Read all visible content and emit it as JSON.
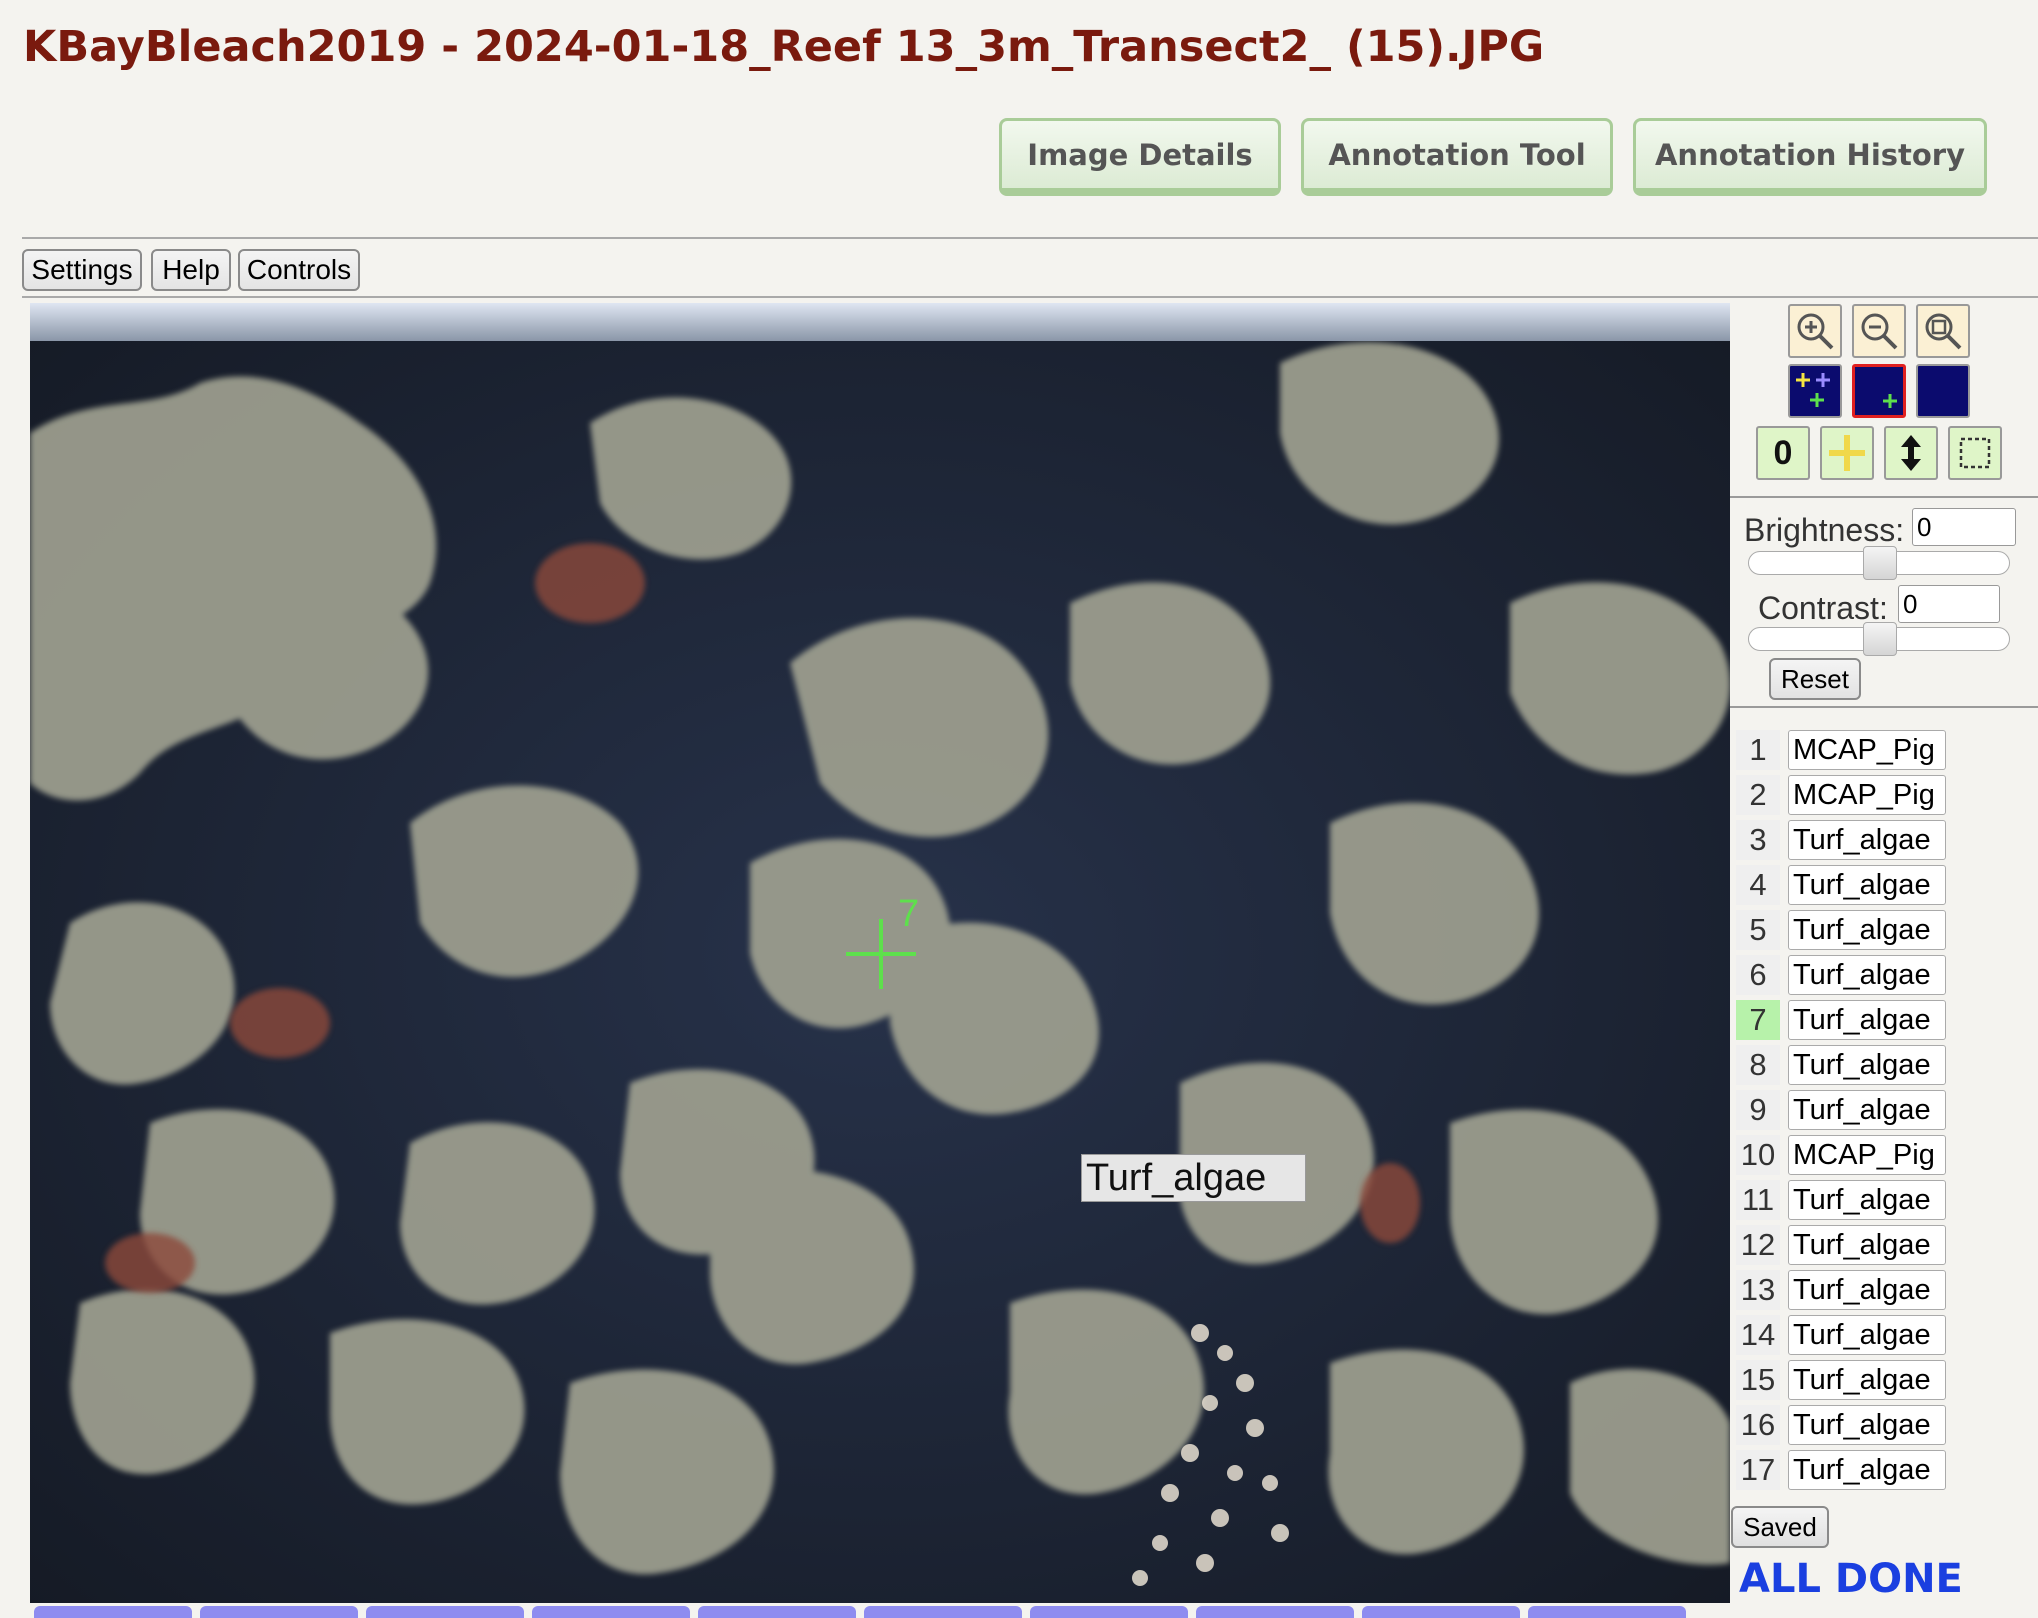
{
  "page": {
    "title": "KBayBleach2019 - 2024-01-18_Reef 13_3m_Transect2_ (15).JPG"
  },
  "tabs": [
    {
      "label": "Image Details"
    },
    {
      "label": "Annotation Tool"
    },
    {
      "label": "Annotation History"
    }
  ],
  "toolbar": {
    "settings_label": "Settings",
    "help_label": "Help",
    "controls_label": "Controls"
  },
  "image": {
    "selected_point_number": "7",
    "hover_label": "Turf_algae"
  },
  "tools": {
    "zoom_in": "zoom-in-icon",
    "zoom_out": "zoom-out-icon",
    "zoom_fit": "zoom-fit-icon",
    "point_mode_all": "point-mode-all-icon",
    "point_mode_selected": "point-mode-selected-icon",
    "point_mode_none": "point-mode-none-icon",
    "number_toggle_label": "0",
    "marker_icon": "yellow-cross-icon",
    "updown_icon": "up-down-arrow-icon",
    "select_icon": "dashed-select-icon"
  },
  "adjust": {
    "brightness_label": "Brightness:",
    "brightness_value": "0",
    "contrast_label": "Contrast:",
    "contrast_value": "0",
    "reset_label": "Reset"
  },
  "annotations": [
    {
      "num": "1",
      "label": "MCAP_Pig"
    },
    {
      "num": "2",
      "label": "MCAP_Pig"
    },
    {
      "num": "3",
      "label": "Turf_algae"
    },
    {
      "num": "4",
      "label": "Turf_algae"
    },
    {
      "num": "5",
      "label": "Turf_algae"
    },
    {
      "num": "6",
      "label": "Turf_algae"
    },
    {
      "num": "7",
      "label": "Turf_algae"
    },
    {
      "num": "8",
      "label": "Turf_algae"
    },
    {
      "num": "9",
      "label": "Turf_algae"
    },
    {
      "num": "10",
      "label": "MCAP_Pig"
    },
    {
      "num": "11",
      "label": "Turf_algae"
    },
    {
      "num": "12",
      "label": "Turf_algae"
    },
    {
      "num": "13",
      "label": "Turf_algae"
    },
    {
      "num": "14",
      "label": "Turf_algae"
    },
    {
      "num": "15",
      "label": "Turf_algae"
    },
    {
      "num": "16",
      "label": "Turf_algae"
    },
    {
      "num": "17",
      "label": "Turf_algae"
    }
  ],
  "status": {
    "saved_label": "Saved",
    "done_text": "ALL DONE"
  },
  "colors": {
    "title": "#7a1a0e",
    "tab_border": "#a9cc98",
    "point_marker": "#5ee04c",
    "current_row": "#b7f2aa",
    "done_text": "#1a3fe0",
    "thumb_strip": "#8e8cf0"
  }
}
